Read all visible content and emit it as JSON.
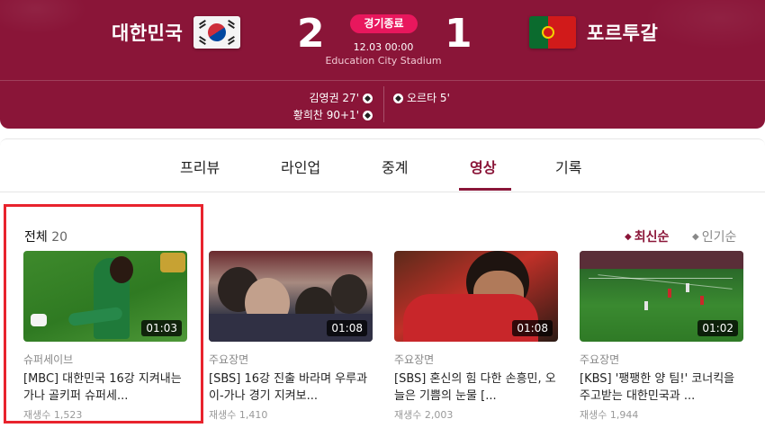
{
  "match": {
    "home_team": "대한민국",
    "away_team": "포르투갈",
    "home_score": "2",
    "away_score": "1",
    "status": "경기종료",
    "datetime": "12.03 00:00",
    "stadium": "Education City Stadium",
    "home_goals": [
      "김영권 27'",
      "황희찬 90+1'"
    ],
    "away_goals": [
      "오르타 5'"
    ]
  },
  "tabs": [
    "프리뷰",
    "라인업",
    "중계",
    "영상",
    "기록"
  ],
  "active_tab": "영상",
  "list": {
    "title": "전체",
    "count": "20",
    "sort_latest": "최신순",
    "sort_popular": "인기순"
  },
  "videos": [
    {
      "duration": "01:03",
      "category": "슈퍼세이브",
      "title": "[MBC] 대한민국 16강 지켜내는 가나 골키퍼 슈퍼세...",
      "views": "재생수 1,523"
    },
    {
      "duration": "01:08",
      "category": "주요장면",
      "title": "[SBS] 16강 진출 바라며 우루과이-가나 경기 지켜보...",
      "views": "재생수 1,410"
    },
    {
      "duration": "01:08",
      "category": "주요장면",
      "title": "[SBS] 혼신의 힘 다한 손흥민, 오늘은 기쁨의 눈물 [...",
      "views": "재생수 2,003"
    },
    {
      "duration": "01:02",
      "category": "주요장면",
      "title": "[KBS] '팽팽한 양 팀!' 코너킥을 주고받는 대한민국과 ...",
      "views": "재생수 1,944"
    }
  ],
  "colors": {
    "brand": "#8a1538",
    "status_badge": "#e8175d",
    "highlight_border": "#e8232d"
  }
}
